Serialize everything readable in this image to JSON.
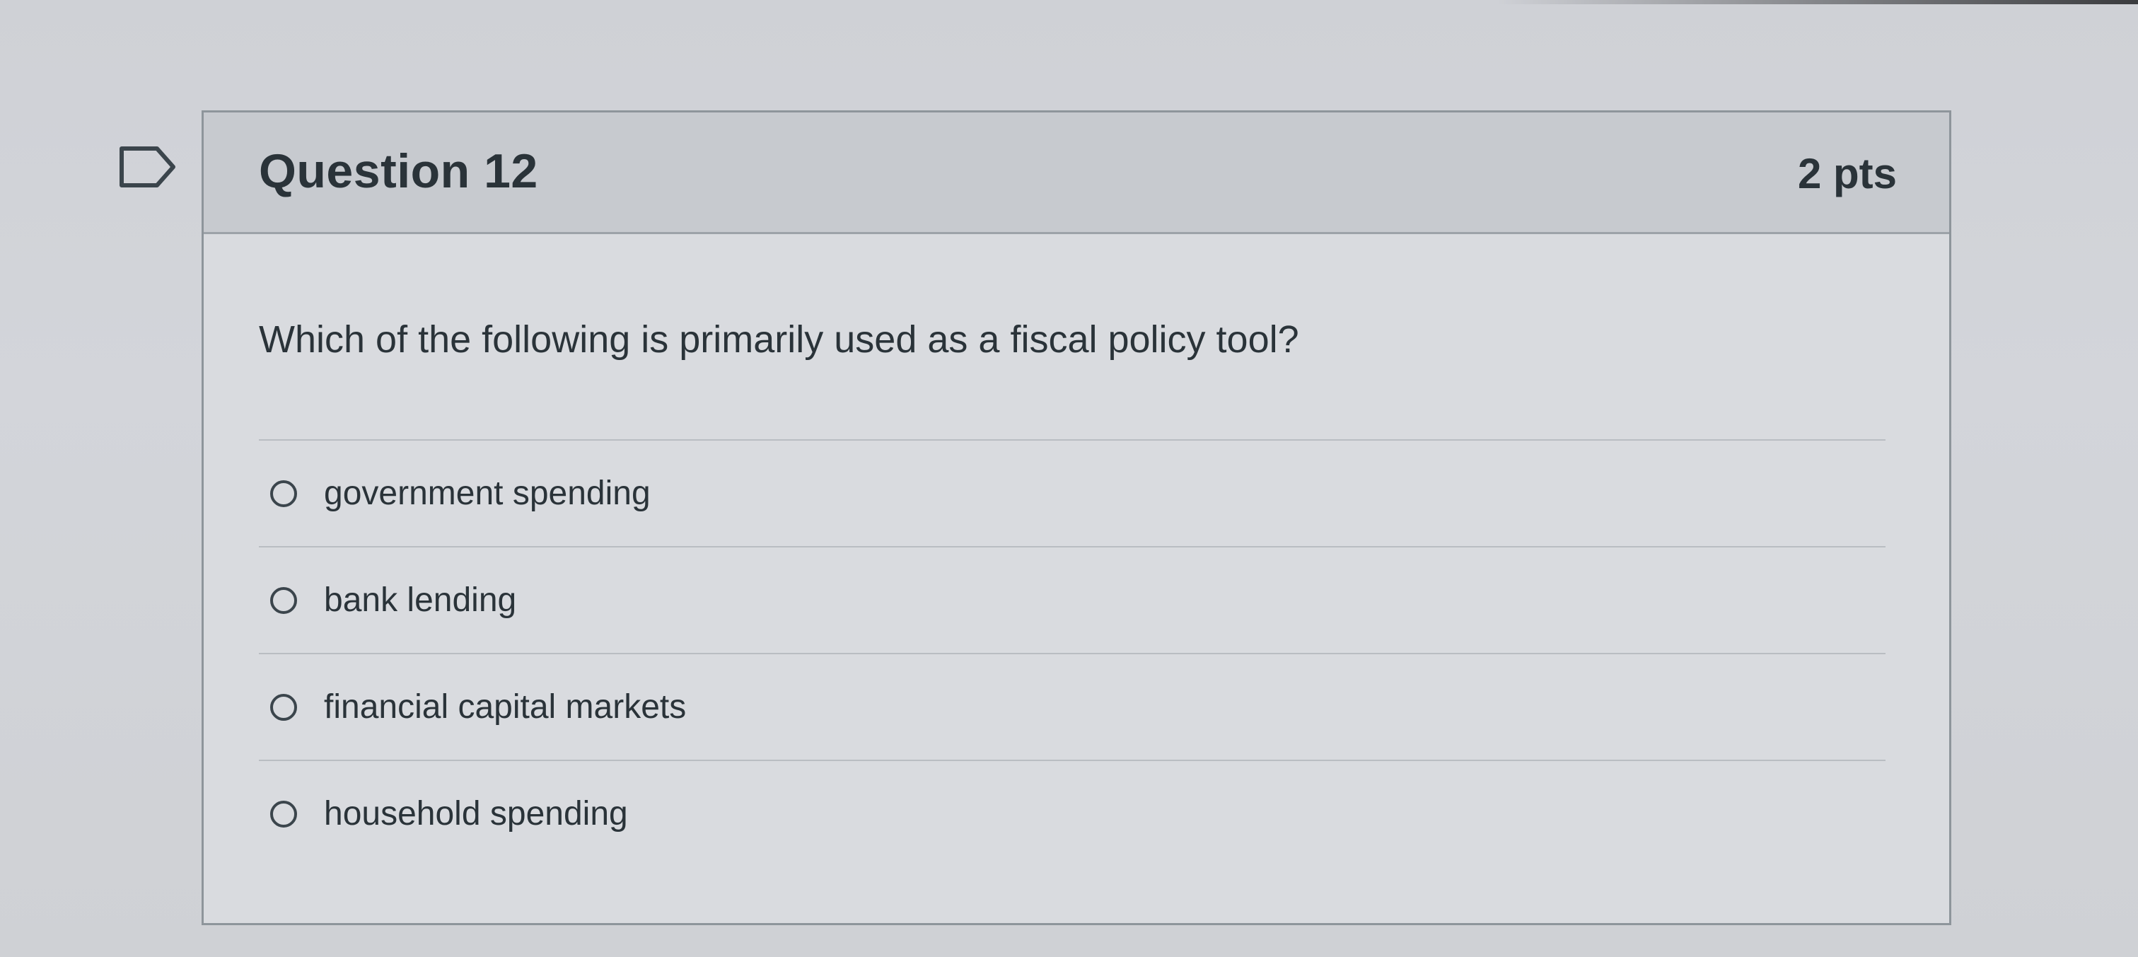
{
  "question": {
    "title": "Question 12",
    "points": "2 pts",
    "text": "Which of the following is primarily used as a fiscal policy tool?",
    "answers": [
      {
        "label": "government spending"
      },
      {
        "label": "bank lending"
      },
      {
        "label": "financial capital markets"
      },
      {
        "label": "household spending"
      }
    ]
  },
  "icons": {
    "flag": "flag-question-icon"
  },
  "colors": {
    "header_background": "#c7cacf",
    "card_background": "#d9dbdf",
    "text": "#2a3339",
    "border": "#8e959b"
  }
}
